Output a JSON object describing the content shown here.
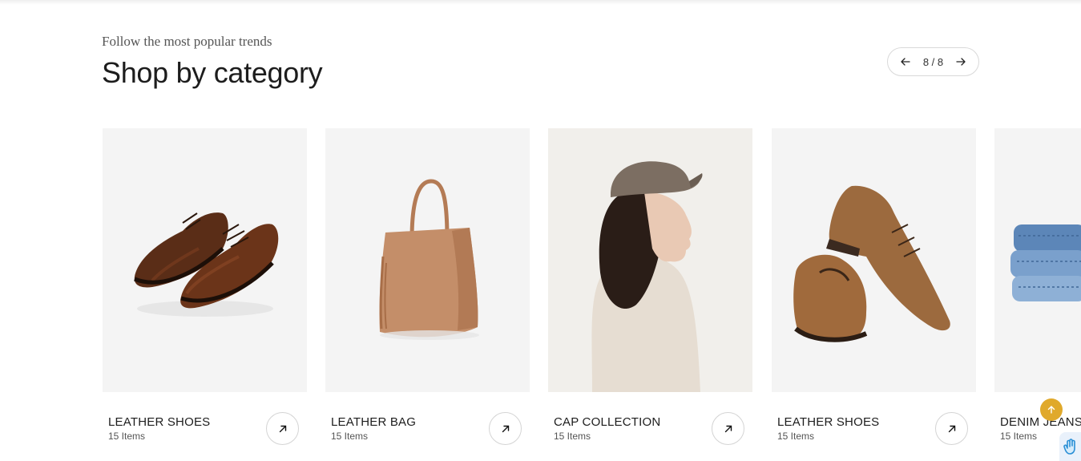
{
  "header": {
    "eyebrow": "Follow the most popular trends",
    "title": "Shop by category"
  },
  "pager": {
    "label": "8 / 8",
    "prev_icon": "arrow-left-icon",
    "next_icon": "arrow-right-icon"
  },
  "categories": [
    {
      "name": "LEATHER SHOES",
      "count": "15 Items",
      "image": "brown-oxford-shoes"
    },
    {
      "name": "LEATHER BAG",
      "count": "15 Items",
      "image": "tan-leather-tote"
    },
    {
      "name": "CAP COLLECTION",
      "count": "15 Items",
      "image": "woman-in-cap"
    },
    {
      "name": "LEATHER SHOES",
      "count": "15 Items",
      "image": "brown-chukka-boots"
    },
    {
      "name": "DENIM JEANS",
      "count": "15 Items",
      "image": "stacked-denim"
    }
  ],
  "colors": {
    "accent": "#e0a92b",
    "card_bg": "#f4f4f4"
  }
}
